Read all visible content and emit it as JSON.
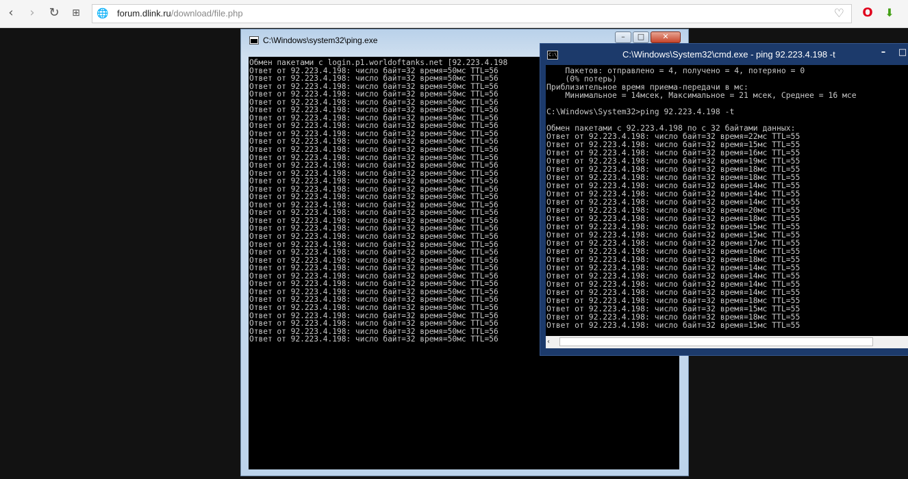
{
  "browser": {
    "url_domain": "forum.dlink.ru",
    "url_path": "/download/file.php"
  },
  "ping_window": {
    "title": "C:\\Windows\\system32\\ping.exe",
    "header_line": "Обмен пакетами с login.p1.worldoftanks.net [92.223.4.198",
    "reply_line": "Ответ от 92.223.4.198: число байт=32 время=50мс TTL=56",
    "reply_count": 35
  },
  "cmd_window": {
    "title": "C:\\Windows\\System32\\cmd.exe - ping  92.223.4.198 -t",
    "icon_text": "C:\\",
    "lines": [
      "    Пакетов: отправлено = 4, получено = 4, потеряно = 0",
      "    (0% потерь)",
      "Приблизительное время приема-передачи в мс:",
      "    Минимальное = 14мсек, Максимальное = 21 мсек, Среднее = 16 мсе",
      "",
      "C:\\Windows\\System32>ping 92.223.4.198 -t",
      "",
      "Обмен пакетами с 92.223.4.198 по с 32 байтами данных:",
      "Ответ от 92.223.4.198: число байт=32 время=22мс TTL=55",
      "Ответ от 92.223.4.198: число байт=32 время=15мс TTL=55",
      "Ответ от 92.223.4.198: число байт=32 время=16мс TTL=55",
      "Ответ от 92.223.4.198: число байт=32 время=19мс TTL=55",
      "Ответ от 92.223.4.198: число байт=32 время=18мс TTL=55",
      "Ответ от 92.223.4.198: число байт=32 время=18мс TTL=55",
      "Ответ от 92.223.4.198: число байт=32 время=14мс TTL=55",
      "Ответ от 92.223.4.198: число байт=32 время=14мс TTL=55",
      "Ответ от 92.223.4.198: число байт=32 время=14мс TTL=55",
      "Ответ от 92.223.4.198: число байт=32 время=20мс TTL=55",
      "Ответ от 92.223.4.198: число байт=32 время=18мс TTL=55",
      "Ответ от 92.223.4.198: число байт=32 время=15мс TTL=55",
      "Ответ от 92.223.4.198: число байт=32 время=15мс TTL=55",
      "Ответ от 92.223.4.198: число байт=32 время=17мс TTL=55",
      "Ответ от 92.223.4.198: число байт=32 время=16мс TTL=55",
      "Ответ от 92.223.4.198: число байт=32 время=18мс TTL=55",
      "Ответ от 92.223.4.198: число байт=32 время=14мс TTL=55",
      "Ответ от 92.223.4.198: число байт=32 время=14мс TTL=55",
      "Ответ от 92.223.4.198: число байт=32 время=14мс TTL=55",
      "Ответ от 92.223.4.198: число байт=32 время=14мс TTL=55",
      "Ответ от 92.223.4.198: число байт=32 время=18мс TTL=55",
      "Ответ от 92.223.4.198: число байт=32 время=15мс TTL=55",
      "Ответ от 92.223.4.198: число байт=32 время=18мс TTL=55",
      "Ответ от 92.223.4.198: число байт=32 время=15мс TTL=55"
    ]
  },
  "icons": {
    "back": "back-arrow-icon",
    "forward": "forward-arrow-icon",
    "reload": "reload-icon",
    "speed_dial": "grid-icon",
    "site": "globe-icon",
    "bookmark": "heart-icon",
    "opera": "opera-logo-icon",
    "download": "download-arrow-icon"
  },
  "colors": {
    "terminal_text": "#c8c8c8",
    "terminal_bg": "#000000",
    "cmd_title_bar": "#1c3a6b",
    "win7_frame": "#b9d1ea"
  }
}
